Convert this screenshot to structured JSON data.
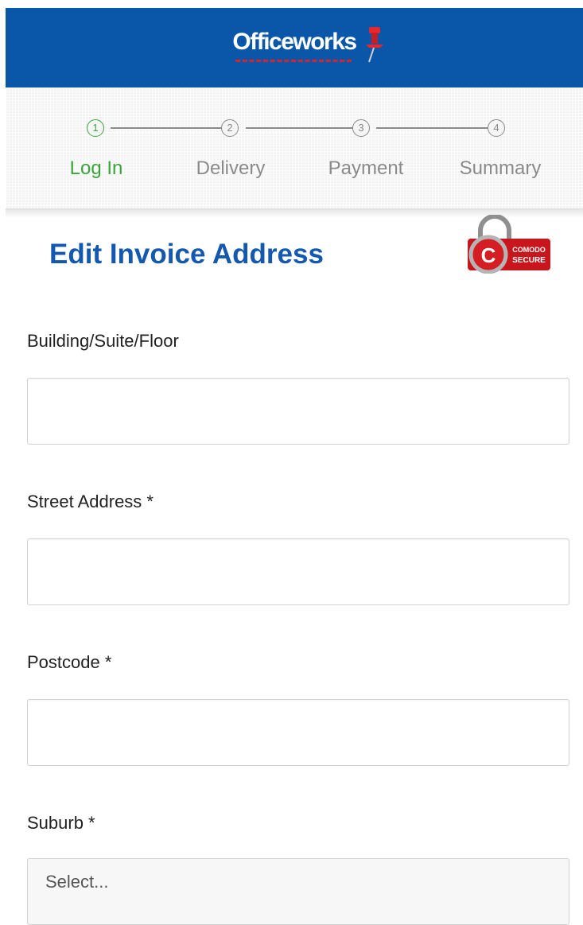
{
  "header": {
    "logo_text": "Officeworks",
    "logo_icon": "pushpin-icon",
    "brand_color": "#0a57aa",
    "accent_color": "#d8232a"
  },
  "steps": [
    {
      "number": "1",
      "label": "Log In",
      "active": true
    },
    {
      "number": "2",
      "label": "Delivery",
      "active": false
    },
    {
      "number": "3",
      "label": "Payment",
      "active": false
    },
    {
      "number": "4",
      "label": "Summary",
      "active": false
    }
  ],
  "step_active_color": "#3aa53a",
  "page": {
    "title": "Edit Invoice Address",
    "title_color": "#1458b0"
  },
  "badge": {
    "brand": "COMODO",
    "text": "SECURE",
    "icon": "padlock-icon"
  },
  "form": {
    "building": {
      "label": "Building/Suite/Floor",
      "value": "",
      "placeholder": ""
    },
    "street": {
      "label": "Street Address  *",
      "value": "",
      "placeholder": ""
    },
    "postcode": {
      "label": "Postcode  *",
      "value": "",
      "placeholder": ""
    },
    "suburb": {
      "label": "Suburb  *",
      "value": "Select..."
    }
  }
}
